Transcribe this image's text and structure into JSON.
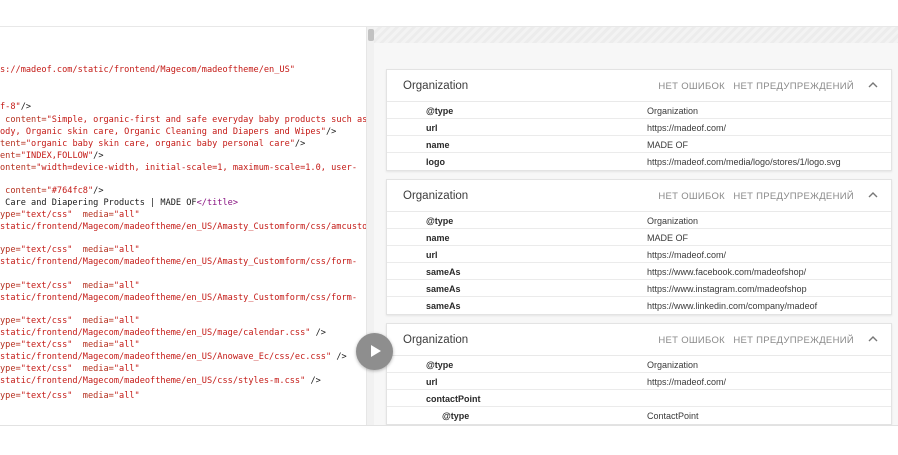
{
  "code": {
    "lines": [
      {
        "parts": [
          {
            "c": "t-str",
            "t": "s://madeof.com/static/frontend/Magecom/madeoftheme/en_US\""
          }
        ]
      },
      {
        "parts": [
          {
            "c": "t-str",
            "t": "f-8\""
          },
          {
            "c": "t-plain",
            "t": "/>"
          }
        ]
      },
      {
        "parts": [
          {
            "c": "t-attr",
            "t": " content="
          },
          {
            "c": "t-str",
            "t": "\"Simple, organic-first and safe everyday baby products such as"
          }
        ]
      },
      {
        "parts": [
          {
            "c": "t-str",
            "t": "ody, Organic skin care, Organic Cleaning and Diapers and Wipes\""
          },
          {
            "c": "t-plain",
            "t": "/>"
          }
        ]
      },
      {
        "parts": [
          {
            "c": "t-attr",
            "t": "tent="
          },
          {
            "c": "t-str",
            "t": "\"organic baby skin care, organic baby personal care\""
          },
          {
            "c": "t-plain",
            "t": "/>"
          }
        ]
      },
      {
        "parts": [
          {
            "c": "t-attr",
            "t": "ent="
          },
          {
            "c": "t-str",
            "t": "\"INDEX,FOLLOW\""
          },
          {
            "c": "t-plain",
            "t": "/>"
          }
        ]
      },
      {
        "parts": [
          {
            "c": "t-attr",
            "t": "ontent="
          },
          {
            "c": "t-str",
            "t": "\"width=device-width, initial-scale=1, maximum-scale=1.0, user-"
          }
        ]
      },
      {
        "parts": [
          {
            "c": "t-attr",
            "t": " content="
          },
          {
            "c": "t-str",
            "t": "\"#764fc8\""
          },
          {
            "c": "t-plain",
            "t": "/>"
          }
        ]
      },
      {
        "parts": [
          {
            "c": "t-plain",
            "t": " Care and Diapering Products | MADE OF"
          },
          {
            "c": "t-kw",
            "t": "</title>"
          }
        ]
      },
      {
        "parts": [
          {
            "c": "t-attr",
            "t": "ype="
          },
          {
            "c": "t-str",
            "t": "\"text/css\""
          },
          {
            "c": "t-attr",
            "t": "  media="
          },
          {
            "c": "t-str",
            "t": "\"all\""
          }
        ]
      },
      {
        "parts": [
          {
            "c": "t-str",
            "t": "static/frontend/Magecom/madeoftheme/en_US/Amasty_Customform/css/amcustomfo"
          }
        ]
      },
      {
        "parts": [
          {
            "c": "t-attr",
            "t": "ype="
          },
          {
            "c": "t-str",
            "t": "\"text/css\""
          },
          {
            "c": "t-attr",
            "t": "  media="
          },
          {
            "c": "t-str",
            "t": "\"all\""
          }
        ]
      },
      {
        "parts": [
          {
            "c": "t-str",
            "t": "static/frontend/Magecom/madeoftheme/en_US/Amasty_Customform/css/form-"
          }
        ]
      },
      {
        "parts": [
          {
            "c": "t-attr",
            "t": "ype="
          },
          {
            "c": "t-str",
            "t": "\"text/css\""
          },
          {
            "c": "t-attr",
            "t": "  media="
          },
          {
            "c": "t-str",
            "t": "\"all\""
          }
        ]
      },
      {
        "parts": [
          {
            "c": "t-str",
            "t": "static/frontend/Magecom/madeoftheme/en_US/Amasty_Customform/css/form-"
          }
        ]
      },
      {
        "parts": [
          {
            "c": "t-attr",
            "t": "ype="
          },
          {
            "c": "t-str",
            "t": "\"text/css\""
          },
          {
            "c": "t-attr",
            "t": "  media="
          },
          {
            "c": "t-str",
            "t": "\"all\""
          }
        ]
      },
      {
        "parts": [
          {
            "c": "t-str",
            "t": "static/frontend/Magecom/madeoftheme/en_US/mage/calendar.css\""
          },
          {
            "c": "t-plain",
            "t": " />"
          }
        ]
      },
      {
        "parts": [
          {
            "c": "t-attr",
            "t": "ype="
          },
          {
            "c": "t-str",
            "t": "\"text/css\""
          },
          {
            "c": "t-attr",
            "t": "  media="
          },
          {
            "c": "t-str",
            "t": "\"all\""
          }
        ]
      },
      {
        "parts": [
          {
            "c": "t-str",
            "t": "static/frontend/Magecom/madeoftheme/en_US/Anowave_Ec/css/ec.css\""
          },
          {
            "c": "t-plain",
            "t": " />"
          }
        ]
      },
      {
        "parts": [
          {
            "c": "t-attr",
            "t": "ype="
          },
          {
            "c": "t-str",
            "t": "\"text/css\""
          },
          {
            "c": "t-attr",
            "t": "  media="
          },
          {
            "c": "t-str",
            "t": "\"all\""
          }
        ]
      },
      {
        "parts": [
          {
            "c": "t-str",
            "t": "static/frontend/Magecom/madeoftheme/en_US/css/styles-m.css\""
          },
          {
            "c": "t-plain",
            "t": " />"
          }
        ]
      },
      {
        "parts": [
          {
            "c": "t-attr",
            "t": "ype="
          },
          {
            "c": "t-str",
            "t": "\"text/css\""
          },
          {
            "c": "t-attr",
            "t": "  media="
          },
          {
            "c": "t-str",
            "t": "\"all\""
          }
        ]
      }
    ]
  },
  "cards": [
    {
      "title": "Organization",
      "errors": "НЕТ ОШИБОК",
      "warnings": "НЕТ ПРЕДУПРЕЖДЕНИЙ",
      "toggle": "^",
      "rows": [
        {
          "key": "@type",
          "value": "Organization"
        },
        {
          "key": "url",
          "value": "https://madeof.com/"
        },
        {
          "key": "name",
          "value": "MADE OF"
        },
        {
          "key": "logo",
          "value": "https://madeof.com/media/logo/stores/1/logo.svg"
        }
      ]
    },
    {
      "title": "Organization",
      "errors": "НЕТ ОШИБОК",
      "warnings": "НЕТ ПРЕДУПРЕЖДЕНИЙ",
      "toggle": "^",
      "rows": [
        {
          "key": "@type",
          "value": "Organization"
        },
        {
          "key": "name",
          "value": "MADE OF"
        },
        {
          "key": "url",
          "value": "https://madeof.com/"
        },
        {
          "key": "sameAs",
          "value": "https://www.facebook.com/madeofshop/"
        },
        {
          "key": "sameAs",
          "value": "https://www.instagram.com/madeofshop"
        },
        {
          "key": "sameAs",
          "value": "https://www.linkedin.com/company/madeof"
        }
      ]
    },
    {
      "title": "Organization",
      "errors": "НЕТ ОШИБОК",
      "warnings": "НЕТ ПРЕДУПРЕЖДЕНИЙ",
      "toggle": "^",
      "rows": [
        {
          "key": "@type",
          "value": "Organization"
        },
        {
          "key": "url",
          "value": "https://madeof.com/"
        },
        {
          "key": "contactPoint",
          "value": ""
        },
        {
          "key": "@type",
          "value": "ContactPoint",
          "nested": true
        }
      ]
    }
  ],
  "icons": {
    "play": "play-icon",
    "collapse": "chevron-up-icon"
  }
}
